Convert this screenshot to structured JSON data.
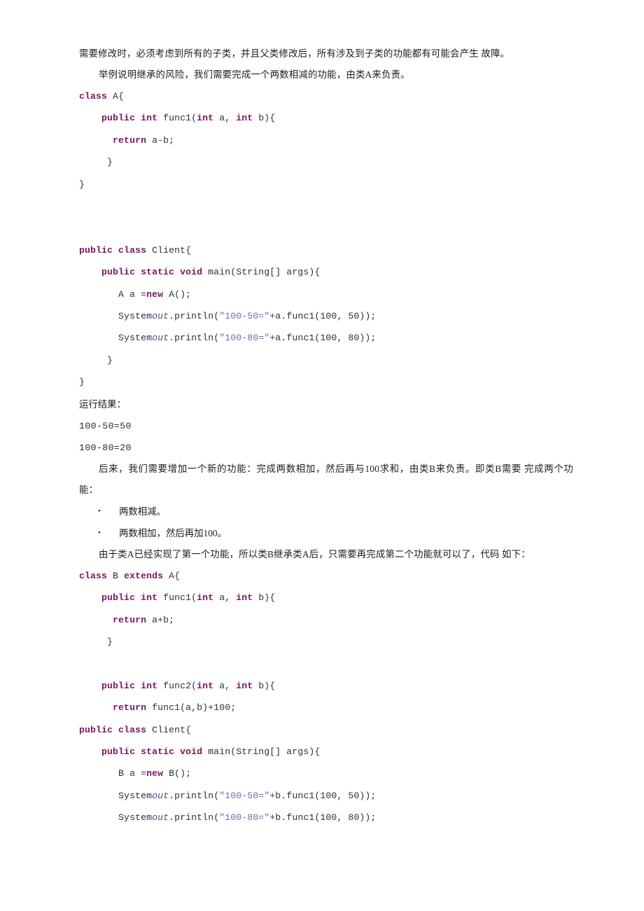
{
  "document": {
    "page_background": "#ffffff",
    "text_color": "#1c1c1c",
    "keyword_color": "#7a1560",
    "string_color": "#6b6bb0",
    "blocks": [
      {
        "id": "para-risk-1",
        "type": "paragraph",
        "indent": false,
        "text": "需要修改时，必须考虑到所有的子类，并且父类修改后，所有涉及到子类的功能都有可能会产生 故障。"
      },
      {
        "id": "para-risk-2",
        "type": "paragraph",
        "indent": true,
        "text": "举例说明继承的风险，我们需要完成一个两数相减的功能，由类A来负责。"
      },
      {
        "id": "code-class-a",
        "type": "code",
        "lines": [
          [
            {
              "t": "class",
              "k": true
            },
            {
              "t": " A{",
              "k": false
            }
          ],
          [
            {
              "t": "    ",
              "k": false
            },
            {
              "t": "public int",
              "k": true
            },
            {
              "t": " func1(",
              "k": false
            },
            {
              "t": "int",
              "k": true
            },
            {
              "t": " a, ",
              "k": false
            },
            {
              "t": "int",
              "k": true
            },
            {
              "t": " b){",
              "k": false
            }
          ],
          [
            {
              "t": "      ",
              "k": false
            },
            {
              "t": "return",
              "k": true
            },
            {
              "t": " a-b;",
              "k": false
            }
          ],
          [
            {
              "t": "     }",
              "k": false
            }
          ],
          [
            {
              "t": "}",
              "k": false
            }
          ],
          [
            {
              "t": "",
              "k": false
            }
          ],
          [
            {
              "t": "",
              "k": false
            }
          ]
        ]
      },
      {
        "id": "code-client-a",
        "type": "code",
        "lines": [
          [
            {
              "t": "public class",
              "k": true
            },
            {
              "t": " Client{",
              "k": false
            }
          ],
          [
            {
              "t": "    ",
              "k": false
            },
            {
              "t": "public static void",
              "k": true
            },
            {
              "t": " main(String[] args){",
              "k": false
            }
          ],
          [
            {
              "t": "       A a =",
              "k": false
            },
            {
              "t": "new",
              "k": true
            },
            {
              "t": " A();",
              "k": false
            }
          ],
          [
            {
              "t": "       System",
              "k": false
            },
            {
              "t": "out",
              "k": false,
              "i": true
            },
            {
              "t": ".println(",
              "k": false
            },
            {
              "t": "\"100-50=\"",
              "k": false,
              "s": true
            },
            {
              "t": "+a.func1(100, 50));",
              "k": false
            }
          ],
          [
            {
              "t": "       System",
              "k": false
            },
            {
              "t": "out",
              "k": false,
              "i": true
            },
            {
              "t": ".println(",
              "k": false
            },
            {
              "t": "\"100-80=\"",
              "k": false,
              "s": true
            },
            {
              "t": "+a.func1(100, 80));",
              "k": false
            }
          ],
          [
            {
              "t": "     }",
              "k": false
            }
          ],
          [
            {
              "t": "}",
              "k": false
            }
          ]
        ]
      },
      {
        "id": "label-result",
        "type": "label",
        "text": "运行结果："
      },
      {
        "id": "output-1",
        "type": "output",
        "text": "100-50=50"
      },
      {
        "id": "output-2",
        "type": "output",
        "text": "100-80=20"
      },
      {
        "id": "para-add-func",
        "type": "paragraph",
        "indent": true,
        "text": "后来，我们需要增加一个新的功能：完成两数相加，然后再与100求和，由类B来负责。即类B需要 完成两个功能："
      },
      {
        "id": "bullet-1",
        "type": "bullet",
        "marker": "•",
        "text": "两数相减。"
      },
      {
        "id": "bullet-2",
        "type": "bullet",
        "marker": "•",
        "text": "两数相加，然后再加100。"
      },
      {
        "id": "para-inherit",
        "type": "paragraph",
        "indent": true,
        "text": "由于类A已经实现了第一个功能，所以类B继承类A后，只需要再完成第二个功能就可以了，代码 如下："
      },
      {
        "id": "code-class-b",
        "type": "code",
        "lines": [
          [
            {
              "t": "class",
              "k": true
            },
            {
              "t": " B ",
              "k": false
            },
            {
              "t": "extends",
              "k": true
            },
            {
              "t": " A{",
              "k": false
            }
          ],
          [
            {
              "t": "    ",
              "k": false
            },
            {
              "t": "public int",
              "k": true
            },
            {
              "t": " func1(",
              "k": false
            },
            {
              "t": "int",
              "k": true
            },
            {
              "t": " a, ",
              "k": false
            },
            {
              "t": "int",
              "k": true
            },
            {
              "t": " b){",
              "k": false
            }
          ],
          [
            {
              "t": "      ",
              "k": false
            },
            {
              "t": "return",
              "k": true
            },
            {
              "t": " a+b;",
              "k": false
            }
          ],
          [
            {
              "t": "     }",
              "k": false
            }
          ],
          [
            {
              "t": "",
              "k": false
            }
          ],
          [
            {
              "t": "    ",
              "k": false
            },
            {
              "t": "public int",
              "k": true
            },
            {
              "t": " func2(",
              "k": false
            },
            {
              "t": "int",
              "k": true
            },
            {
              "t": " a, ",
              "k": false
            },
            {
              "t": "int",
              "k": true
            },
            {
              "t": " b){",
              "k": false
            }
          ],
          [
            {
              "t": "      ",
              "k": false
            },
            {
              "t": "return",
              "k": true
            },
            {
              "t": " func1(a,b)+100;",
              "k": false
            }
          ]
        ]
      },
      {
        "id": "code-client-b",
        "type": "code",
        "lines": [
          [
            {
              "t": "public class",
              "k": true
            },
            {
              "t": " Client{",
              "k": false
            }
          ],
          [
            {
              "t": "    ",
              "k": false
            },
            {
              "t": "public static void",
              "k": true
            },
            {
              "t": " main(String[] args){",
              "k": false
            }
          ],
          [
            {
              "t": "       B a =",
              "k": false
            },
            {
              "t": "new",
              "k": true
            },
            {
              "t": " B();",
              "k": false
            }
          ],
          [
            {
              "t": "       System",
              "k": false
            },
            {
              "t": "out",
              "k": false,
              "i": true
            },
            {
              "t": ".println(",
              "k": false
            },
            {
              "t": "\"100-50=\"",
              "k": false,
              "s": true
            },
            {
              "t": "+b.func1(100, 50));",
              "k": false
            }
          ],
          [
            {
              "t": "       System",
              "k": false
            },
            {
              "t": "out",
              "k": false,
              "i": true
            },
            {
              "t": ".println(",
              "k": false
            },
            {
              "t": "\"100-80=\"",
              "k": false,
              "s": true
            },
            {
              "t": "+b.func1(100, 80));",
              "k": false
            }
          ]
        ]
      }
    ]
  }
}
